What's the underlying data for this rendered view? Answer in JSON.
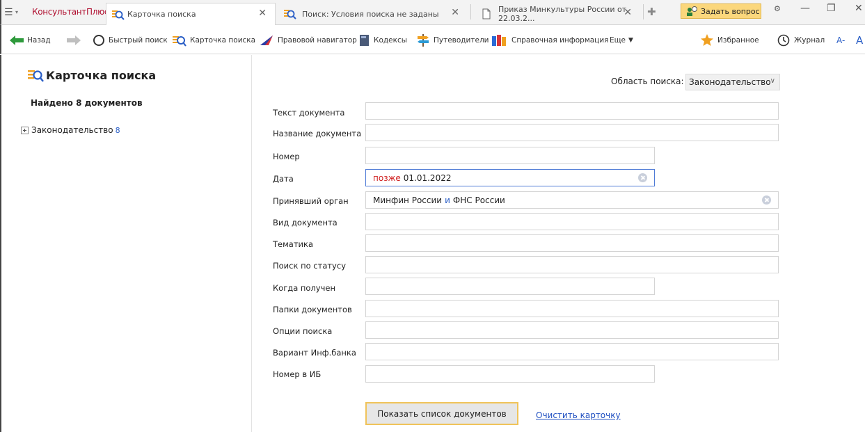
{
  "tabbar": {
    "brand": "КонсультантПлюс",
    "tabs": [
      {
        "label": "Карточка поиска"
      },
      {
        "label": "Поиск: Условия поиска не заданы"
      },
      {
        "label": "Приказ Минкультуры России от 22.03.2..."
      }
    ],
    "ask_label": "Задать вопрос"
  },
  "toolbar": {
    "back": "Назад",
    "quick_search": "Быстрый поиск",
    "search_card": "Карточка поиска",
    "legal_nav": "Правовой навигатор",
    "codes": "Кодексы",
    "guides": "Путеводители",
    "reference": "Справочная информация",
    "more": "Еще",
    "favorites": "Избранное",
    "journal": "Журнал",
    "font_small": "A-",
    "font_big": "A"
  },
  "left": {
    "title": "Карточка поиска",
    "found": "Найдено 8 документов",
    "tree_label": "Законодательство",
    "tree_count": "8"
  },
  "form": {
    "area_label": "Область поиска:",
    "area_value": "Законодательство",
    "rows": [
      {
        "label": "Текст документа",
        "value": ""
      },
      {
        "label": "Название документа",
        "value": ""
      },
      {
        "label": "Номер",
        "value": ""
      },
      {
        "label": "Дата",
        "keyword": "позже",
        "value": "01.01.2022"
      },
      {
        "label": "Принявший орган",
        "value1": "Минфин России",
        "conj": "и",
        "value2": "ФНС России"
      },
      {
        "label": "Вид документа",
        "value": ""
      },
      {
        "label": "Тематика",
        "value": ""
      },
      {
        "label": "Поиск по статусу",
        "value": ""
      },
      {
        "label": "Когда получен",
        "value": ""
      },
      {
        "label": "Папки документов",
        "value": ""
      },
      {
        "label": "Опции поиска",
        "value": ""
      },
      {
        "label": "Вариант Инф.банка",
        "value": ""
      },
      {
        "label": "Номер в ИБ",
        "value": ""
      }
    ],
    "show_button": "Показать список документов",
    "clear_link": "Очистить карточку"
  },
  "colors": {
    "accent_blue": "#4f7bd6",
    "brand_red": "#b01030",
    "ask_yellow": "#fbd77c",
    "keyword_red": "#d02020",
    "link_blue": "#1f4fc1"
  },
  "icons": [
    "menu-icon",
    "search-card-icon",
    "document-icon",
    "add-tab-icon",
    "ask-question-icon",
    "minimize-icon",
    "restore-icon",
    "close-icon",
    "back-arrow-icon",
    "forward-arrow-icon",
    "quick-search-icon",
    "legal-navigator-icon",
    "codes-icon",
    "guides-icon",
    "reference-icon",
    "star-icon",
    "history-icon",
    "clear-field-icon"
  ]
}
